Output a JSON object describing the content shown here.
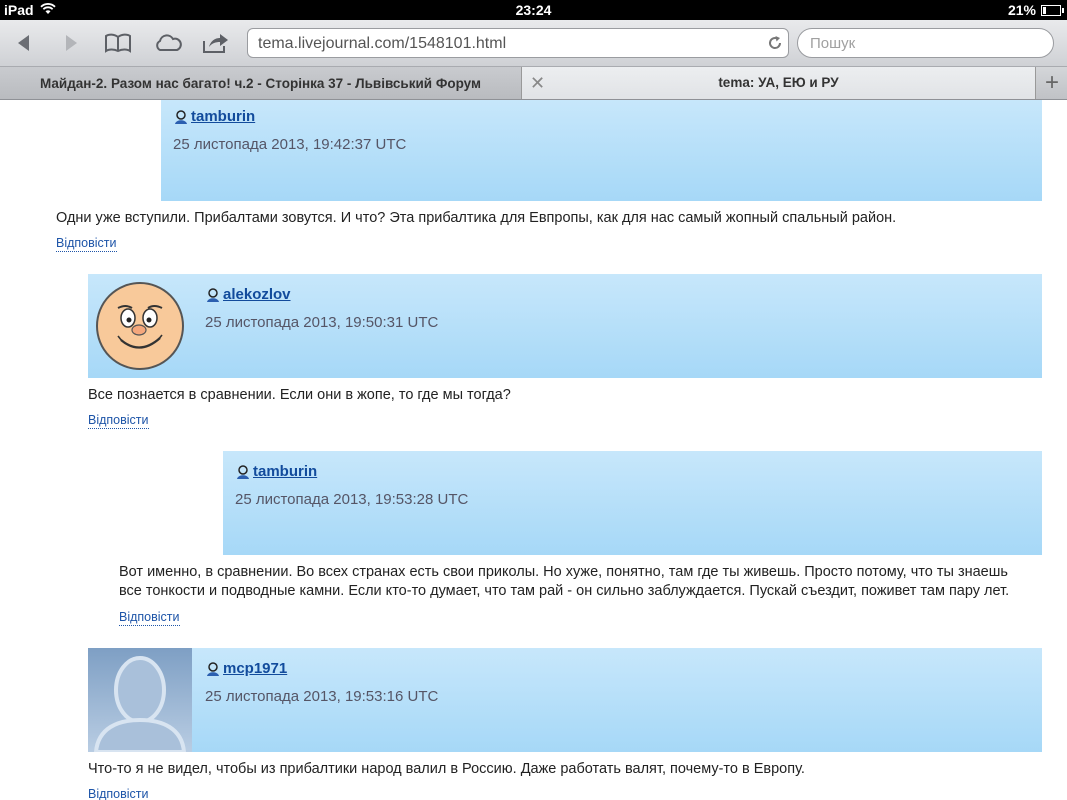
{
  "status": {
    "device": "iPad",
    "time": "23:24",
    "battery": "21%",
    "battery_level": 0.21
  },
  "toolbar": {
    "url": "tema.livejournal.com/1548101.html",
    "search_placeholder": "Пошук"
  },
  "tabs": [
    {
      "title": "Майдан-2. Разом нас багато! ч.2 - Сторінка 37 - Львівський Форум"
    },
    {
      "title": "tema: УА, ЕЮ и РУ"
    }
  ],
  "comments": [
    {
      "user": "tamburin",
      "date": "25 листопада 2013, 19:42:37 UTC",
      "text": "Одни уже вступили. Прибалтами зовутся. И что? Эта прибалтика для Евпропы, как для нас самый жопный спальный район.",
      "reply": "Відповісти",
      "avatar": "none"
    },
    {
      "user": "alekozlov",
      "date": "25 листопада 2013, 19:50:31 UTC",
      "text": "Все познается в сравнении. Если они в жопе, то где мы тогда?",
      "reply": "Відповісти",
      "avatar": "cartoon-face"
    },
    {
      "user": "tamburin",
      "date": "25 листопада 2013, 19:53:28 UTC",
      "text_line1": "Вот именно, в сравнении. Во всех странах есть свои приколы. Но хуже, понятно, там где ты живешь. Просто потому, что ты знаешь",
      "text_line2": "все тонкости и подводные камни. Если кто-то думает, что там рай - он сильно заблуждается. Пускай съездит, поживет там пару лет.",
      "reply": "Відповісти",
      "avatar": "none"
    },
    {
      "user": "mcp1971",
      "date": "25 листопада 2013, 19:53:16 UTC",
      "text": "Что-то я не видел, чтобы из прибалтики народ валил в Россию. Даже работать валят, почему-то в Европу.",
      "reply": "Відповісти",
      "avatar": "default-silhouette"
    }
  ]
}
